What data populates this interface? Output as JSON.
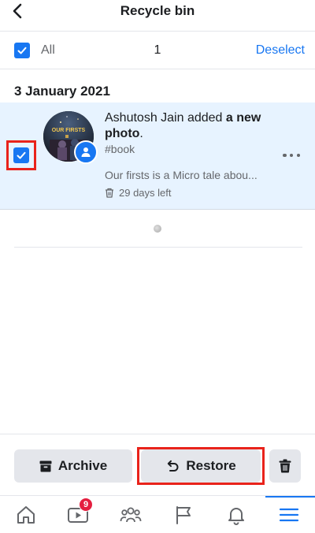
{
  "header": {
    "title": "Recycle bin",
    "back_icon": "chevron-left-icon"
  },
  "select_bar": {
    "all_label": "All",
    "all_checked": true,
    "selected_count": "1",
    "deselect_label": "Deselect"
  },
  "section": {
    "date": "3 January 2021"
  },
  "items": [
    {
      "author": "Ashutosh Jain",
      "action_prefix": " added ",
      "action_bold": "a new photo",
      "action_suffix": ".",
      "tag": "#book",
      "description": "Our firsts is a Micro tale abou...",
      "days_left": "29 days left",
      "checked": true,
      "thumbnail_text": "OUR FIRSTS"
    }
  ],
  "actions": {
    "archive_label": "Archive",
    "restore_label": "Restore",
    "delete_icon": "trash-icon"
  },
  "tabbar": {
    "tabs": [
      {
        "name": "home",
        "icon": "home-icon"
      },
      {
        "name": "watch",
        "icon": "video-icon",
        "badge": "9"
      },
      {
        "name": "groups",
        "icon": "groups-icon"
      },
      {
        "name": "pages",
        "icon": "flag-icon"
      },
      {
        "name": "notifications",
        "icon": "bell-icon"
      },
      {
        "name": "menu",
        "icon": "menu-icon",
        "active": true
      }
    ]
  },
  "colors": {
    "accent": "#1877f2",
    "highlight_frame": "#e9231b",
    "selected_row": "#e7f3ff",
    "badge": "#e41e3f"
  }
}
